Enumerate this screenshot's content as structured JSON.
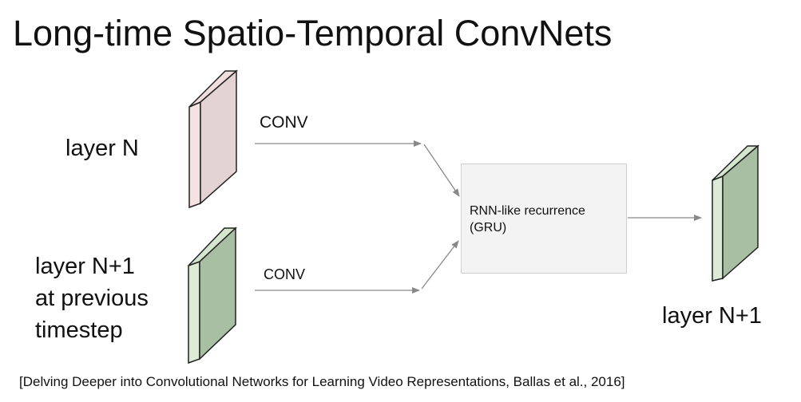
{
  "title": "Long-time Spatio-Temporal ConvNets",
  "layers": {
    "input_current": "layer N",
    "input_previous": [
      "layer N+1",
      "at previous",
      "timestep"
    ],
    "output": "layer N+1"
  },
  "operations": {
    "conv_top": "CONV",
    "conv_bottom": "CONV",
    "recurrence": [
      "RNN-like recurrence",
      "(GRU)"
    ]
  },
  "citation": "[Delving Deeper into Convolutional Networks for Learning Video Representations, Ballas et al., 2016]",
  "colors": {
    "layer_n_front": "#e3d3d3",
    "layer_n_side": "#f5e2e2",
    "green_front": "#a9bfa4",
    "green_side": "#dcebd6",
    "arrow": "#888888",
    "box_fill": "#f3f3f3"
  }
}
